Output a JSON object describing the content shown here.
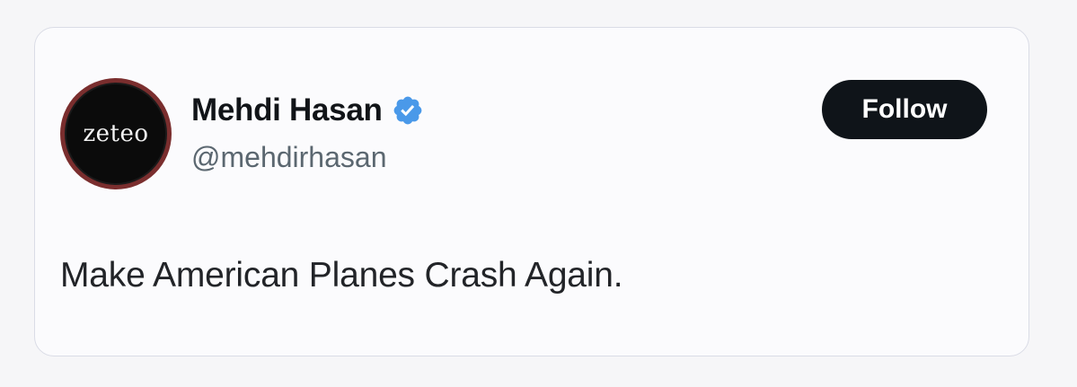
{
  "tweet": {
    "avatar": {
      "logo_text": "zeteo"
    },
    "author": {
      "display_name": "Mehdi Hasan",
      "handle": "@mehdirhasan",
      "verified_icon": "verified-badge-icon"
    },
    "follow_label": "Follow",
    "text": "Make American Planes Crash Again."
  },
  "colors": {
    "verified": "#4a99e9",
    "follow_bg": "#0f1419",
    "handle": "#5b6770"
  }
}
